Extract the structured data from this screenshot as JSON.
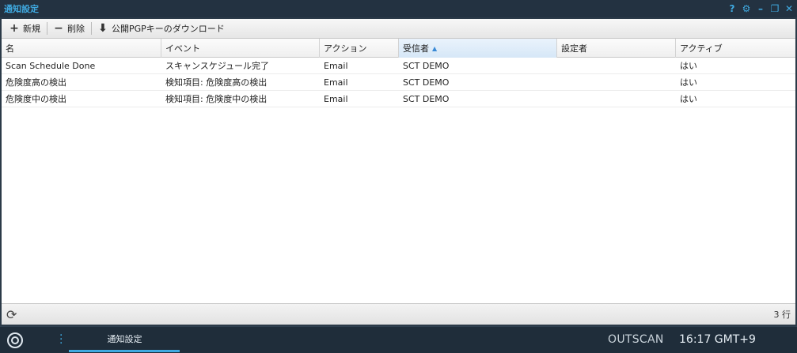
{
  "window": {
    "title": "通知設定",
    "controls": {
      "help": "?",
      "settings": "⚙",
      "minimize": "–",
      "restore": "❐",
      "close": "✕"
    }
  },
  "toolbar": {
    "new_icon": "+",
    "new_label": "新規",
    "delete_icon": "−",
    "delete_label": "削除",
    "download_icon": "⬇",
    "download_label": "公開PGPキーのダウンロード"
  },
  "table": {
    "columns": [
      "名",
      "イベント",
      "アクション",
      "受信者",
      "設定者",
      "アクティブ"
    ],
    "sorted_column": "受信者",
    "sort_direction": "asc",
    "rows": [
      [
        "Scan Schedule Done",
        "スキャンスケジュール完了",
        "Email",
        "SCT DEMO",
        "",
        "はい"
      ],
      [
        "危険度高の検出",
        "検知項目: 危険度高の検出",
        "Email",
        "SCT DEMO",
        "",
        "はい"
      ],
      [
        "危険度中の検出",
        "検知項目: 危険度中の検出",
        "Email",
        "SCT DEMO",
        "",
        "はい"
      ]
    ]
  },
  "statusbar": {
    "refresh_icon": "⟳",
    "row_count": "3 行"
  },
  "taskbar": {
    "tab_label": "通知設定",
    "brand": "OUTSCAN",
    "clock": "16:17 GMT+9"
  },
  "colors": {
    "accent": "#3fa9e0",
    "titlebar": "#233241",
    "taskbar": "#1f2d3a"
  }
}
